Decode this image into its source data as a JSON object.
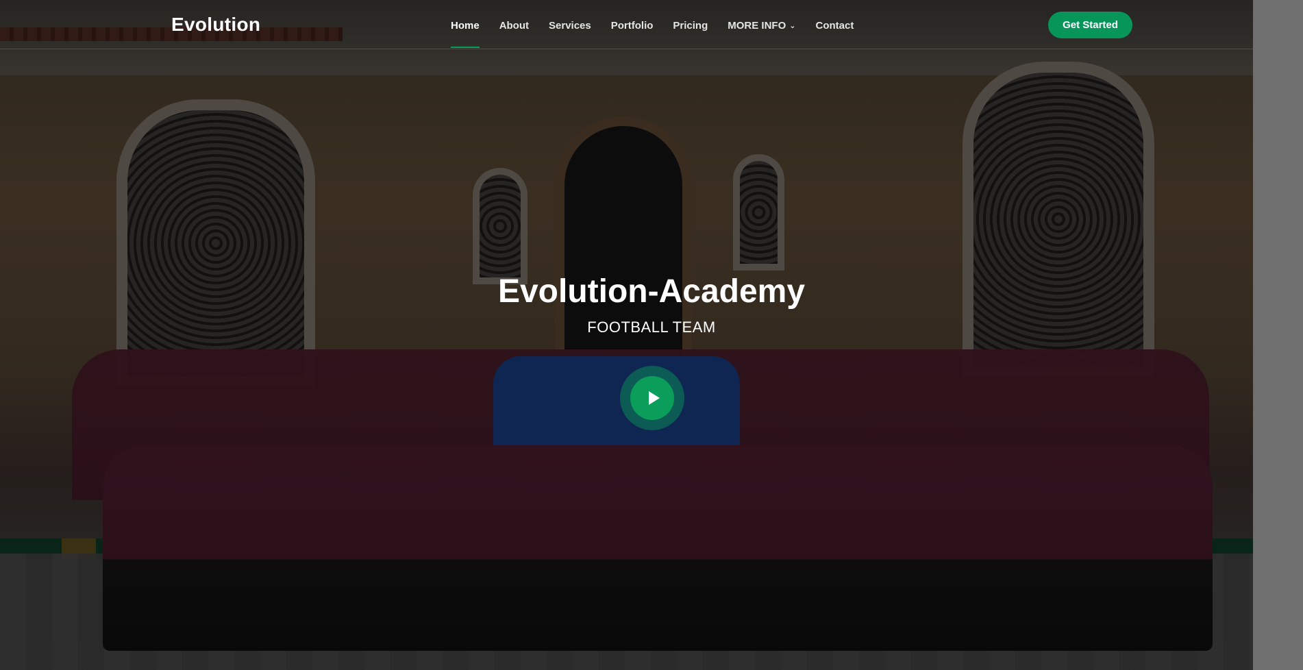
{
  "header": {
    "logo": "Evolution",
    "nav": [
      {
        "label": "Home",
        "active": true
      },
      {
        "label": "About"
      },
      {
        "label": "Services"
      },
      {
        "label": "Portfolio"
      },
      {
        "label": "Pricing"
      },
      {
        "label": "MORE INFO",
        "dropdown": true
      },
      {
        "label": "Contact"
      }
    ],
    "cta_label": "Get Started"
  },
  "hero": {
    "title": "Evolution-Academy",
    "subtitle": "FOOTBALL TEAM",
    "play_icon": "play-icon"
  },
  "colors": {
    "accent": "#0b9e5a",
    "text": "#ffffff"
  }
}
